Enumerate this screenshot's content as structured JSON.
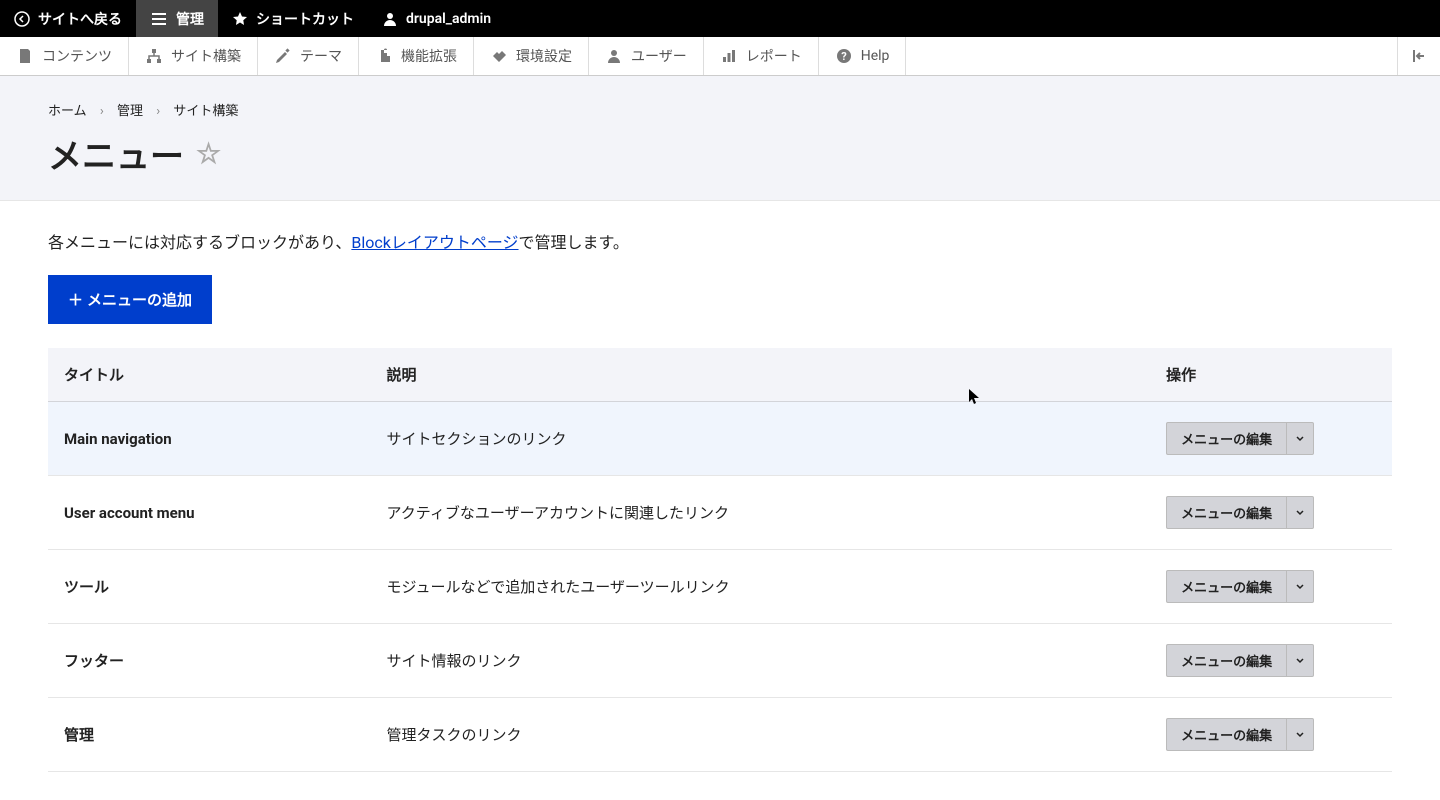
{
  "toolbar_top": {
    "back_to_site": "サイトへ戻る",
    "manage": "管理",
    "shortcuts": "ショートカット",
    "user": "drupal_admin"
  },
  "toolbar_second": {
    "content": "コンテンツ",
    "structure": "サイト構築",
    "appearance": "テーマ",
    "extend": "機能拡張",
    "configuration": "環境設定",
    "people": "ユーザー",
    "reports": "レポート",
    "help": "Help"
  },
  "breadcrumb": {
    "home": "ホーム",
    "admin": "管理",
    "structure": "サイト構築"
  },
  "page_title": "メニュー",
  "intro": {
    "before": "各メニューには対応するブロックがあり、",
    "link": "Blockレイアウトページ",
    "after": "で管理します。"
  },
  "add_button": "メニューの追加",
  "table": {
    "headers": {
      "title": "タイトル",
      "description": "説明",
      "operations": "操作"
    },
    "edit_label": "メニューの編集",
    "rows": [
      {
        "title": "Main navigation",
        "desc": "サイトセクションのリンク",
        "hover": true
      },
      {
        "title": "User account menu",
        "desc": "アクティブなユーザーアカウントに関連したリンク",
        "hover": false
      },
      {
        "title": "ツール",
        "desc": "モジュールなどで追加されたユーザーツールリンク",
        "hover": false
      },
      {
        "title": "フッター",
        "desc": "サイト情報のリンク",
        "hover": false
      },
      {
        "title": "管理",
        "desc": "管理タスクのリンク",
        "hover": false
      }
    ]
  }
}
